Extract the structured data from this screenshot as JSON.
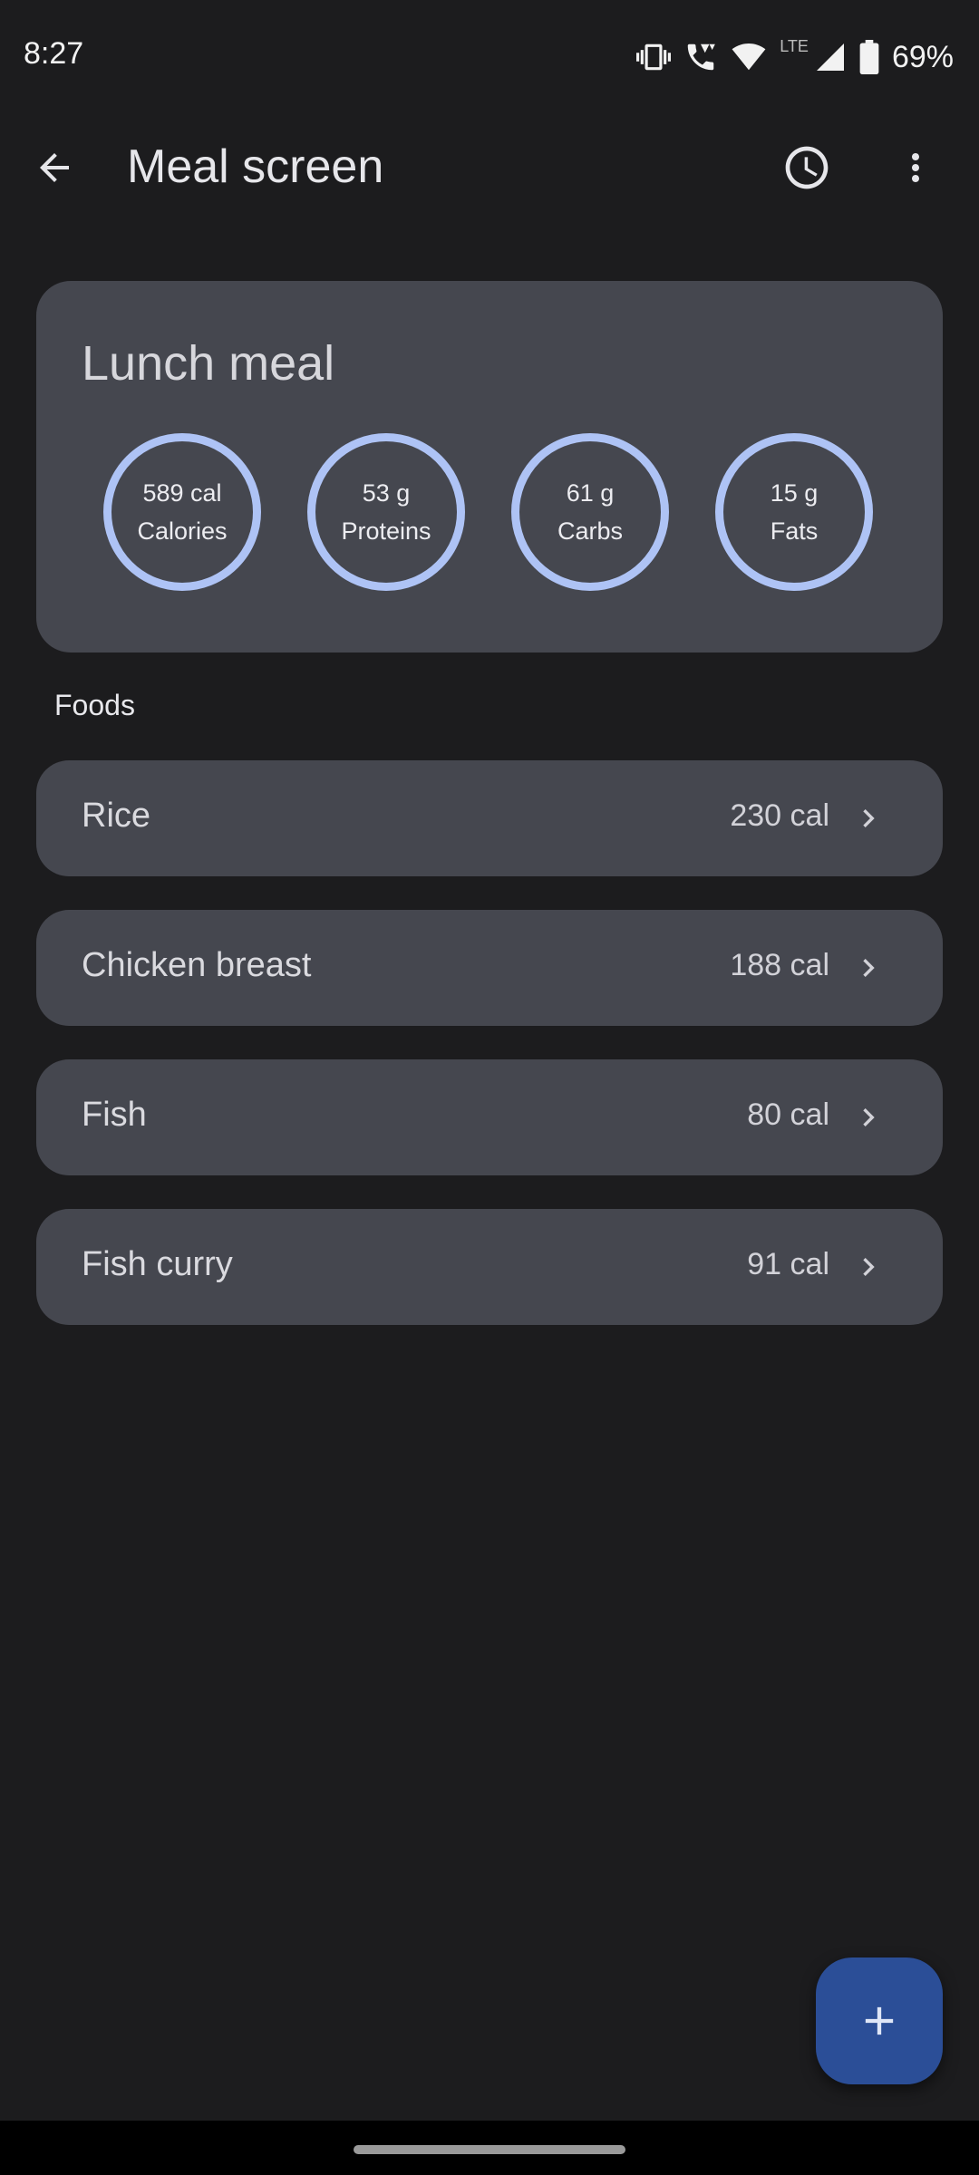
{
  "status_bar": {
    "time": "8:27",
    "network": "LTE",
    "battery": "69%"
  },
  "app_bar": {
    "title": "Meal screen",
    "icons": [
      "back-arrow-icon",
      "history-clock-icon",
      "more-vert-icon"
    ]
  },
  "meal": {
    "title": "Lunch meal",
    "nutrients": [
      {
        "value": "589 cal",
        "label": "Calories"
      },
      {
        "value": "53 g",
        "label": "Proteins"
      },
      {
        "value": "61 g",
        "label": "Carbs"
      },
      {
        "value": "15 g",
        "label": "Fats"
      }
    ],
    "ring_color": "#aec3f5"
  },
  "foods": {
    "heading": "Foods",
    "items": [
      {
        "name": "Rice",
        "calories": "230 cal"
      },
      {
        "name": "Chicken breast",
        "calories": "188 cal"
      },
      {
        "name": "Fish",
        "calories": "80 cal"
      },
      {
        "name": "Fish curry",
        "calories": "91 cal"
      }
    ]
  },
  "fab": {
    "icon": "plus-icon",
    "color": "#2b4e97"
  },
  "colors": {
    "background": "#1c1c1e",
    "card": "#45474f",
    "accent": "#aec3f5"
  }
}
